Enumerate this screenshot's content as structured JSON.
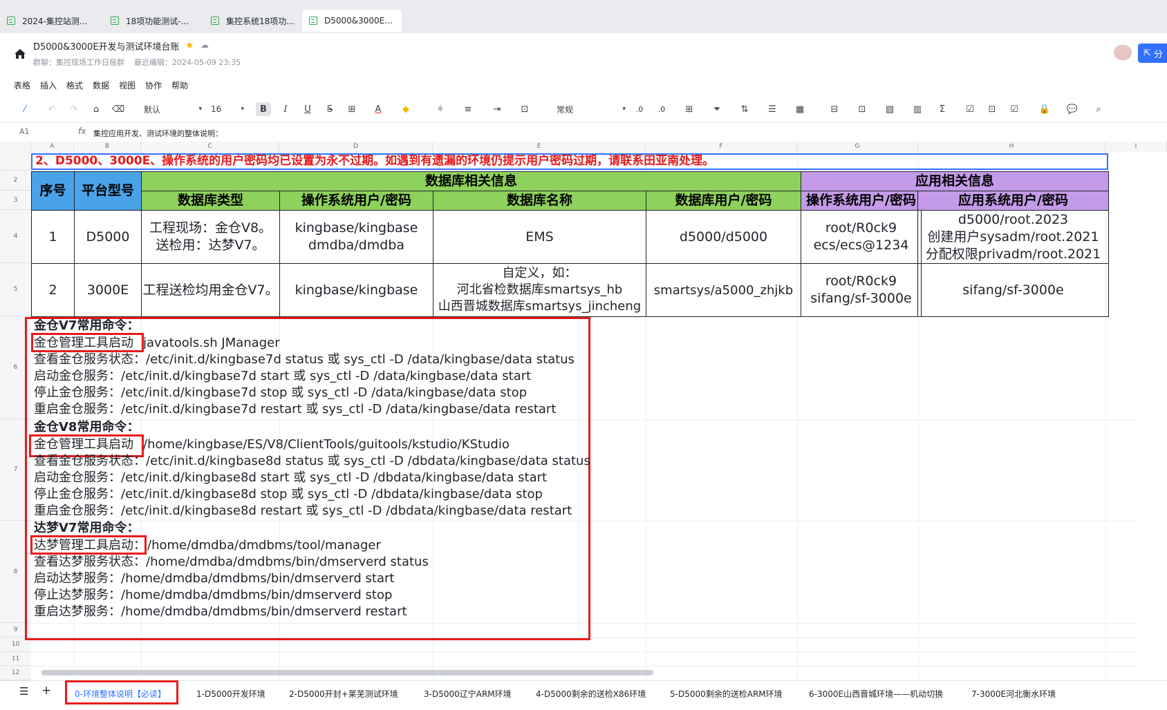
{
  "browser_tabs": [
    {
      "label": "2024-集控站测..."
    },
    {
      "label": "18项功能测试-..."
    },
    {
      "label": "集控系统18项功..."
    },
    {
      "label": "D5000&3000E..."
    }
  ],
  "doc": {
    "title": "D5000&3000E开发与测试环境台账",
    "group": "群聊：集控现场工作日报群",
    "last_edit": "最近编辑：2024-05-09 23:35",
    "share_label": "分"
  },
  "menu": [
    "表格",
    "插入",
    "格式",
    "数据",
    "视图",
    "协作",
    "帮助"
  ],
  "toolbar": {
    "font": "默认",
    "size": "16",
    "number_format": "常规"
  },
  "formula_bar": {
    "cell_ref": "A1",
    "fx": "fx",
    "content": "集控应用开发、测试环境的整体说明："
  },
  "columns": [
    "A",
    "B",
    "C",
    "D",
    "E",
    "F",
    "G",
    "H",
    "I"
  ],
  "rows": [
    "2",
    "3",
    "4",
    "5",
    "6",
    "7",
    "8",
    "9",
    "10",
    "11",
    "12"
  ],
  "notice": "2、D5000、3000E、操作系统的用户密码均已设置为永不过期。如遇到有遗漏的环境仍提示用户密码过期，请联系田亚南处理。",
  "table": {
    "h_seq": "序号",
    "h_platform": "平台型号",
    "h_db_group": "数据库相关信息",
    "h_app_group": "应用相关信息",
    "h_db_type": "数据库类型",
    "h_os_user": "操作系统用户/密码",
    "h_db_name": "数据库名称",
    "h_db_user": "数据库用户/密码",
    "h_app_os_user": "操作系统用户/密码",
    "h_app_user": "应用系统用户/密码",
    "row1": {
      "seq": "1",
      "platform": "D5000",
      "db_type_1": "工程现场：金仓V8。",
      "db_type_2": "送检用：达梦V7。",
      "os_user_1": "kingbase/kingbase",
      "os_user_2": "dmdba/dmdba",
      "db_name": "EMS",
      "db_user": "d5000/d5000",
      "app_os_1": "root/R0ck9",
      "app_os_2": "ecs/ecs@1234",
      "app_user_1": "d5000/root.2023",
      "app_user_2": "创建用户sysadm/root.2021",
      "app_user_3": "分配权限privadm/root.2021"
    },
    "row2": {
      "seq": "2",
      "platform": "3000E",
      "db_type": "工程送检均用金仓V7。",
      "os_user": "kingbase/kingbase",
      "db_name_1": "自定义，如：",
      "db_name_2": "河北省检数据库smartsys_hb",
      "db_name_3": "山西晋城数据库smartsys_jincheng",
      "db_user": "smartsys/a5000_zhjkb",
      "app_os_1": "root/R0ck9",
      "app_os_2": "sifang/sf-3000e",
      "app_user": "sifang/sf-3000e"
    }
  },
  "commands": {
    "v7_head": "金仓V7常用命令：",
    "v7_tool_label": "金仓管理工具启动",
    "v7_tool_cmd": "javatools.sh  JManager",
    "v7_status": "查看金仓服务状态：/etc/init.d/kingbase7d status 或 sys_ctl -D /data/kingbase/data status",
    "v7_start": "启动金仓服务：/etc/init.d/kingbase7d start 或 sys_ctl -D /data/kingbase/data start",
    "v7_stop": "停止金仓服务：/etc/init.d/kingbase7d stop 或 sys_ctl -D /data/kingbase/data stop",
    "v7_restart": "重启金仓服务：/etc/init.d/kingbase7d restart 或 sys_ctl -D /data/kingbase/data restart",
    "v8_head": "金仓V8常用命令：",
    "v8_tool_label": "金仓管理工具启动",
    "v8_tool_cmd": "/home/kingbase/ES/V8/ClientTools/guitools/kstudio/KStudio",
    "v8_status": "查看金仓服务状态：/etc/init.d/kingbase8d status 或 sys_ctl -D /dbdata/kingbase/data status",
    "v8_start": "启动金仓服务：/etc/init.d/kingbase8d start 或 sys_ctl -D /dbdata/kingbase/data start",
    "v8_stop": "停止金仓服务：/etc/init.d/kingbase8d stop 或 sys_ctl -D /dbdata/kingbase/data stop",
    "v8_restart": "重启金仓服务：/etc/init.d/kingbase8d restart 或 sys_ctl -D /dbdata/kingbase/data restart",
    "dm_head": "达梦V7常用命令：",
    "dm_tool_label": "达梦管理工具启动：",
    "dm_tool_cmd": "/home/dmdba/dmdbms/tool/manager",
    "dm_status": "查看达梦服务状态：/home/dmdba/dmdbms/bin/dmserverd status",
    "dm_start": "启动达梦服务：/home/dmdba/dmdbms/bin/dmserverd start",
    "dm_stop": "停止达梦服务：/home/dmdba/dmdbms/bin/dmserverd stop",
    "dm_restart": "重启达梦服务：/home/dmdba/dmdbms/bin/dmserverd restart"
  },
  "sheet_tabs": [
    "0-环境整体说明【必读】",
    "1-D5000开发环境",
    "2-D5000开封+莱芜测试环境",
    "3-D5000辽宁ARM环境",
    "4-D5000剩余的送检X86环境",
    "5-D5000剩余的送检ARM环境",
    "6-3000E山西晋城环境——机动切换",
    "7-3000E河北衡水环境"
  ],
  "colors": {
    "header_blue": "#4aa3e8",
    "header_green": "#8ed15c",
    "header_purple": "#c49be8",
    "highlight_red": "#e81a1a",
    "accent": "#3370ff"
  }
}
